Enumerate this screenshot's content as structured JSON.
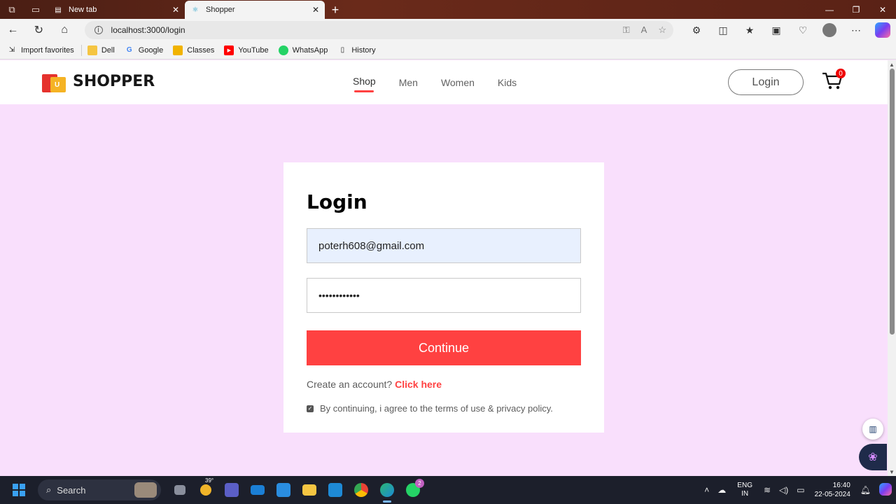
{
  "browser": {
    "tabs": [
      {
        "label": "New tab",
        "active": false
      },
      {
        "label": "Shopper",
        "active": true
      }
    ],
    "url": "localhost:3000/login",
    "favorites": [
      {
        "label": "Import favorites",
        "icon": "import-icon"
      },
      {
        "label": "Dell",
        "icon": "folder-icon"
      },
      {
        "label": "Google",
        "icon": "google-icon"
      },
      {
        "label": "Classes",
        "icon": "classroom-icon"
      },
      {
        "label": "YouTube",
        "icon": "youtube-icon"
      },
      {
        "label": "WhatsApp",
        "icon": "whatsapp-icon"
      },
      {
        "label": "History",
        "icon": "history-icon"
      }
    ]
  },
  "site": {
    "logo_text": "SHOPPER",
    "logo_badge": "U",
    "menu": [
      {
        "label": "Shop",
        "active": true
      },
      {
        "label": "Men",
        "active": false
      },
      {
        "label": "Women",
        "active": false
      },
      {
        "label": "Kids",
        "active": false
      }
    ],
    "login_button": "Login",
    "cart_count": "0"
  },
  "login": {
    "title": "Login",
    "email_value": "poterh608@gmail.com",
    "password_value": "••••••••••••",
    "continue_label": "Continue",
    "signup_text": "Create an account?",
    "signup_link": "Click here",
    "agree_text": "By continuing, i agree to the terms of use & privacy policy.",
    "agree_checked": true
  },
  "taskbar": {
    "search_label": "Search",
    "weather_temp": "39°",
    "whatsapp_badge": "2",
    "language_line1": "ENG",
    "language_line2": "IN",
    "time": "16:40",
    "date": "22-05-2024"
  },
  "colors": {
    "accent": "#ff4141",
    "page_bg": "#f9dffc",
    "email_field_bg": "#e8f0fe"
  }
}
